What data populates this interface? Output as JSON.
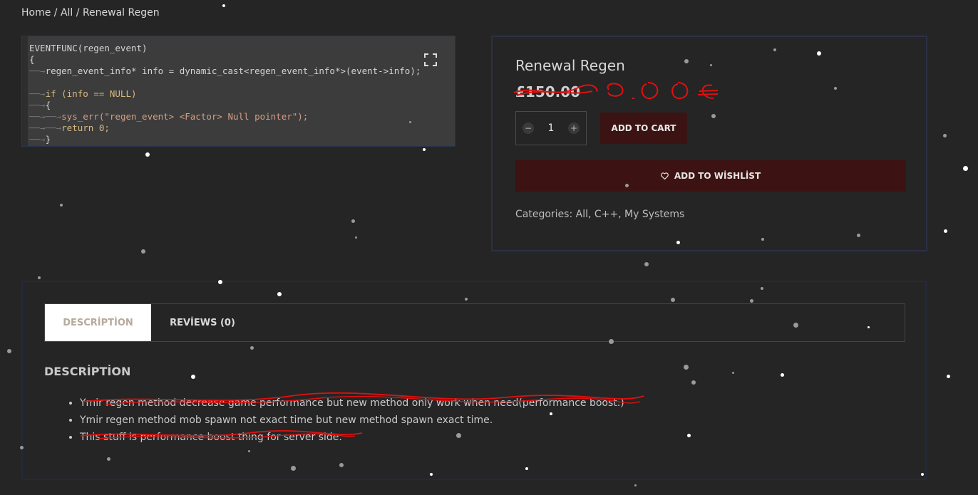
{
  "breadcrumb": {
    "home": "Home",
    "sep1": " / ",
    "all": "All",
    "sep2": " / ",
    "current": "Renewal Regen"
  },
  "code_image": {
    "lines": [
      "EVENTFUNC(regen_event)",
      "{",
      "regen_event_info* info = dynamic_cast<regen_event_info*>(event->info);",
      "if (info == NULL)",
      "{",
      "sys_err(\"regen_event> <Factor> Null pointer\");",
      "return 0;",
      "}"
    ],
    "expand_icon": "expand-icon"
  },
  "product": {
    "title": "Renewal Regen",
    "price": "£150.00",
    "price_handwritten": "0.00€",
    "quantity": "1",
    "qty_minus": "−",
    "qty_plus": "+",
    "add_to_cart": "ADD TO CART",
    "wishlist_label": "ADD TO WİSHLİST",
    "wishlist_icon": "heart-icon",
    "categories_label": "Categories: ",
    "categories": "All, C++, My Systems"
  },
  "tabs": {
    "description": "DESCRİPTİON",
    "reviews": "REVİEWS (0)"
  },
  "description": {
    "heading": "DESCRİPTİON",
    "items": [
      "Ymir regen method decrease game performance but new method only work when need(performance boost.)",
      "Ymir regen method mob spawn not exact time but new method spawn exact time.",
      "This stuff is performance boost thing for server side."
    ]
  },
  "colors": {
    "background": "#252525",
    "button_red": "#3b1313",
    "border_blue": "#2b3146",
    "scribble_red": "#e01010"
  }
}
